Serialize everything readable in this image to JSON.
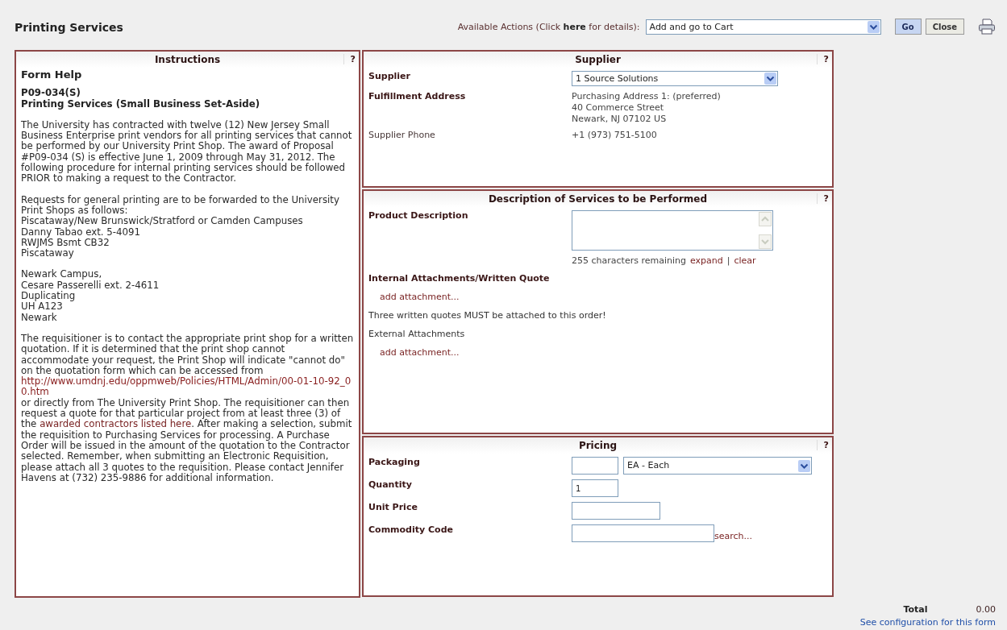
{
  "header": {
    "title": "Printing Services",
    "actions_label_before": "Available Actions (Click ",
    "actions_link": "here",
    "actions_label_after": " for details):",
    "action": "Add and go to Cart",
    "buttons": [
      {
        "kind": "go",
        "label": "Go"
      },
      {
        "kind": "close",
        "label": "Close"
      }
    ]
  },
  "instructions": {
    "title": "Instructions",
    "help": "?",
    "heading": "Form Help",
    "code": "P09-034(S)",
    "subtitle": "Printing Services (Small Business Set-Aside)",
    "blocks": [
      {
        "kind": "paragraph",
        "parts": [
          {
            "kind": "text",
            "text": "The University has contracted with twelve (12) New Jersey Small Business Enterprise print vendors for all printing services that cannot be performed by our University Print Shop. The award of Proposal #P09-034 (S) is effective June 1, 2009 through May 31, 2012. The following procedure for internal printing services should be followed PRIOR to making a request to the Contractor."
          }
        ]
      },
      {
        "kind": "lines",
        "lines": [
          "Requests for general printing are to be forwarded to the University Print Shops as follows:",
          "Piscataway/New Brunswick/Stratford or Camden Campuses",
          "Danny Tabao ext. 5-4091",
          "RWJMS Bsmt CB32",
          "Piscataway"
        ]
      },
      {
        "kind": "lines",
        "lines": [
          "Newark Campus,",
          "Cesare Passerelli ext. 2-4611",
          "Duplicating",
          "UH A123",
          "Newark"
        ]
      },
      {
        "kind": "paragraph",
        "parts": [
          {
            "kind": "text",
            "text": "The requisitioner is to contact the appropriate print shop for a written quotation. If it is determined that the print shop cannot accommodate your request, the Print Shop will indicate \"cannot do\" on the quotation form which can be accessed from "
          },
          {
            "kind": "url",
            "text": "http://www.umdnj.edu/oppmweb/Policies/HTML/Admin/00-01-10-92_00.htm"
          },
          {
            "kind": "text",
            "text": " or directly from The University Print Shop. The requisitioner can then request a quote for that particular project from at least three (3) of the "
          },
          {
            "kind": "link",
            "text": "awarded contractors listed here"
          },
          {
            "kind": "text",
            "text": ". After making a selection, submit the requisition to Purchasing Services for processing. A Purchase Order will be issued in the amount of the quotation to the Contractor selected. Remember, when submitting an Electronic Requisition, please attach all 3 quotes to the requisition. Please contact Jennifer Havens at (732) 235-9886 for additional information."
          }
        ]
      }
    ]
  },
  "supplier": {
    "title": "Supplier",
    "help": "?",
    "supplier_label": "Supplier",
    "supplier_value": "1 Source Solutions",
    "address_label": "Fulfillment Address",
    "address_lines": [
      "Purchasing Address 1: (preferred)",
      "40 Commerce Street",
      "Newark, NJ 07102 US"
    ],
    "phone_label": "Supplier Phone",
    "phone": "+1 (973) 751-5100"
  },
  "description": {
    "title": "Description of Services to be Performed",
    "help": "?",
    "product_label": "Product Description",
    "remaining": "255 characters remaining",
    "expand": "expand",
    "separator": "|",
    "clear": "clear",
    "internal_label": "Internal Attachments/Written Quote",
    "internal_add": "add attachment...",
    "notice": "Three written quotes MUST be attached to this order!",
    "external_label": "External Attachments",
    "external_add": "add attachment..."
  },
  "pricing": {
    "title": "Pricing",
    "help": "?",
    "packaging_label": "Packaging",
    "packaging_unit": "EA - Each",
    "quantity_label": "Quantity",
    "quantity": "1",
    "unit_price_label": "Unit Price",
    "commodity_label": "Commodity Code",
    "search": "search..."
  },
  "footer": {
    "total_label": "Total",
    "total": "0.00",
    "config_link": "See configuration for this form"
  }
}
